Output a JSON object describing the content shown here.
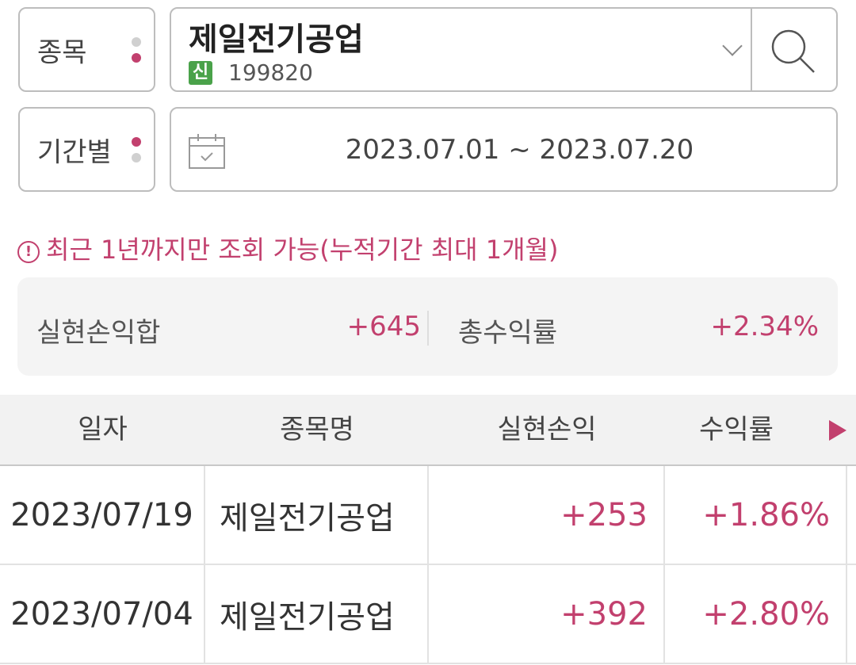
{
  "filters": {
    "stock_label": "종목",
    "period_label": "기간별"
  },
  "stock": {
    "name": "제일전기공업",
    "badge": "신",
    "code": "199820"
  },
  "period": {
    "range": "2023.07.01 ~ 2023.07.20"
  },
  "notice": {
    "icon": "!",
    "text": "최근 1년까지만 조회 가능(누적기간 최대 1개월)"
  },
  "summary": {
    "realized_label": "실현손익합",
    "realized_value": "+645",
    "return_label": "총수익률",
    "return_value": "+2.34%"
  },
  "table": {
    "headers": [
      "일자",
      "종목명",
      "실현손익",
      "수익률"
    ],
    "rows": [
      {
        "date": "2023/07/19",
        "name": "제일전기공업",
        "pnl": "+253",
        "rate": "+1.86%"
      },
      {
        "date": "2023/07/04",
        "name": "제일전기공업",
        "pnl": "+392",
        "rate": "+2.80%"
      }
    ]
  },
  "colors": {
    "accent": "#c2406e",
    "badge_green": "#4aa24a",
    "border": "#bdbdbd"
  },
  "icons": [
    "search-icon",
    "chevron-down-icon",
    "calendar-icon",
    "info-icon",
    "play-right-icon"
  ]
}
